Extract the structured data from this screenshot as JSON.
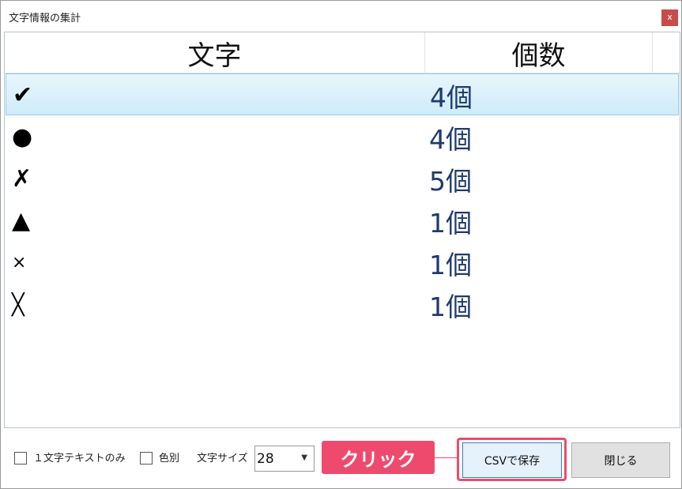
{
  "window": {
    "title": "文字情報の集計",
    "close_label": "x"
  },
  "grid": {
    "headers": [
      "文字",
      "個数"
    ],
    "rows": [
      {
        "char": "✔",
        "count": "4個",
        "selected": true
      },
      {
        "char": "●",
        "count": "4個",
        "selected": false
      },
      {
        "char": "✗",
        "count": "5個",
        "selected": false
      },
      {
        "char": "▲",
        "count": "1個",
        "selected": false
      },
      {
        "char": "×",
        "count": "1個",
        "selected": false
      },
      {
        "char": "╳",
        "count": "1個",
        "selected": false
      }
    ]
  },
  "options": {
    "one_char_text_only_label": "１文字テキストのみ",
    "one_char_text_only_checked": false,
    "by_color_label": "色別",
    "by_color_checked": false,
    "font_size_label": "文字サイズ",
    "font_size_value": "28"
  },
  "annotation": {
    "callout_text": "クリック"
  },
  "buttons": {
    "save_csv_label": "CSVで保存",
    "close_label": "閉じる"
  },
  "colors": {
    "accent": "#ee4a6d",
    "selected_row": "#cfebf9",
    "count_text": "#1f3a6e",
    "close_button": "#c64b4b"
  }
}
